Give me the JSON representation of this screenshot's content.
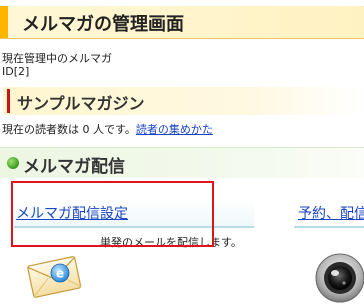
{
  "header": {
    "title": "メルマガの管理画面"
  },
  "current": {
    "label": "現在管理中のメルマガ",
    "id": "ID[2]"
  },
  "magazine": {
    "name": "サンプルマガジン"
  },
  "readers": {
    "text": "現在の読者数は 0 人です。",
    "link": "読者の集めかた"
  },
  "section": {
    "title": "メルマガ配信"
  },
  "tabs": {
    "settings_label": "メルマガ配信設定",
    "reserve_label": "予約、配信"
  },
  "send": {
    "description": "単発のメールを配信します。"
  },
  "icons": {
    "mail": "mail-envelope-icon",
    "camera": "camera-lens-icon"
  },
  "colors": {
    "header_accent": "#fdb500",
    "magazine_accent": "#c5141b",
    "section_dot": "#3a9c1d",
    "link": "#1a44c4",
    "highlight": "#e0141c"
  }
}
